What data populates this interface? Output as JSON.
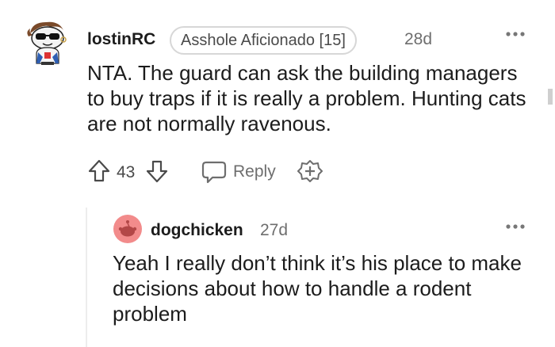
{
  "comment": {
    "username": "lostinRC",
    "flair": "Asshole Aficionado [15]",
    "age": "28d",
    "more_icon": "more-options-icon",
    "body": "NTA. The guard can ask the building managers to buy traps if it is really a problem. Hunting cats are not normally ravenous.",
    "score": "43",
    "reply_label": "Reply"
  },
  "reply": {
    "username": "dogchicken",
    "age": "27d",
    "more_icon": "more-options-icon",
    "body": "Yeah I really don’t think it’s his place to make decisions about how to handle a rodent problem",
    "avatar_color": "#f28b8b"
  },
  "icons": {
    "upvote": "upvote-arrow-icon",
    "downvote": "downvote-arrow-icon",
    "reply": "speech-bubble-icon",
    "award": "award-plus-icon"
  }
}
